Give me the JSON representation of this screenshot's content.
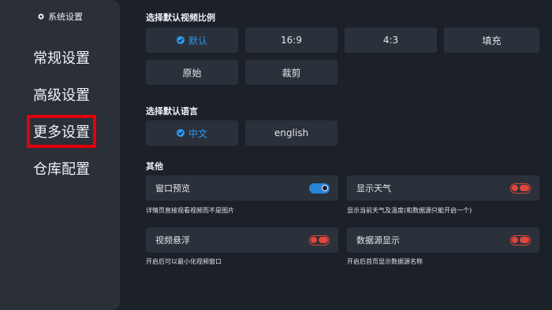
{
  "sidebar": {
    "header": "系统设置",
    "items": [
      {
        "label": "常规设置"
      },
      {
        "label": "高级设置"
      },
      {
        "label": "更多设置"
      },
      {
        "label": "仓库配置"
      }
    ]
  },
  "aspect": {
    "title": "选择默认视频比例",
    "options": [
      "默认",
      "16:9",
      "4:3",
      "填充",
      "原始",
      "裁剪"
    ],
    "selected": "默认"
  },
  "language": {
    "title": "选择默认语言",
    "options": [
      "中文",
      "english"
    ],
    "selected": "中文"
  },
  "other": {
    "title": "其他",
    "toggles": [
      {
        "label": "窗口预览",
        "on": true,
        "hint": "详情页直接观看视频而不是图片"
      },
      {
        "label": "显示天气",
        "on": false,
        "hint": "显示当前天气及温度(和数据源只能开启一个)"
      },
      {
        "label": "视频悬浮",
        "on": false,
        "hint": "开启后可以最小化视频窗口"
      },
      {
        "label": "数据源显示",
        "on": false,
        "hint": "开启后首页显示数据源名称"
      }
    ]
  },
  "colors": {
    "accent": "#2a9bf0",
    "toggle_off": "#e0463c",
    "highlight_border": "#e3000b"
  }
}
